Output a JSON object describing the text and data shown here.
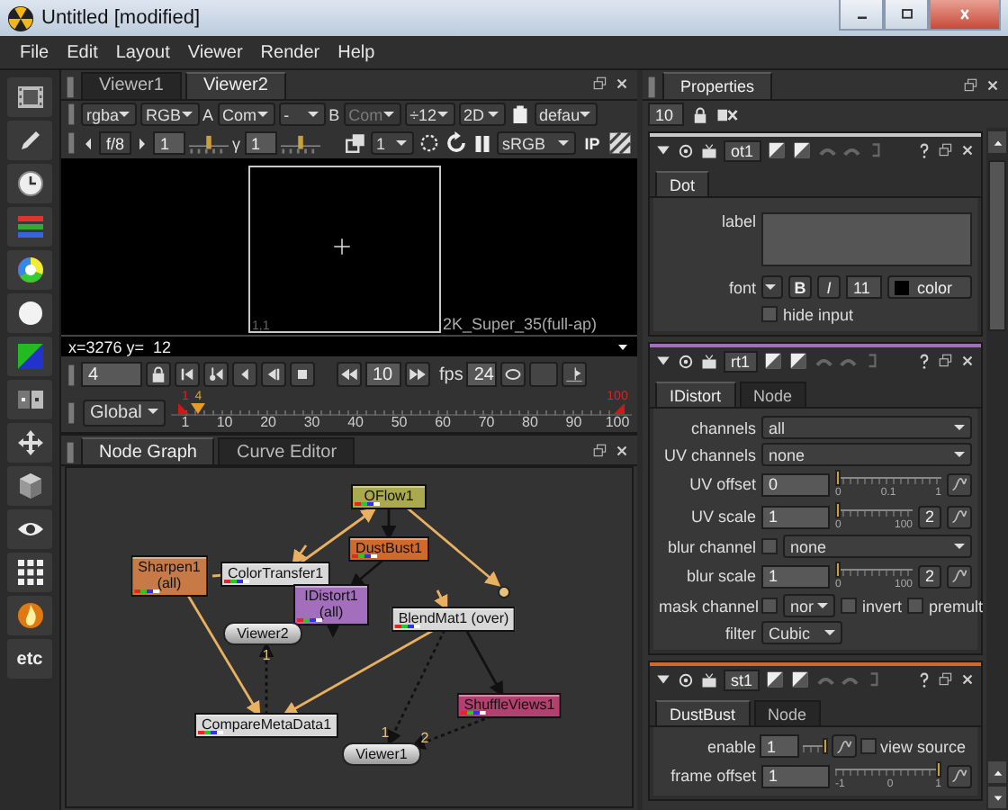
{
  "window": {
    "title": "Untitled [modified]"
  },
  "menu": [
    "File",
    "Edit",
    "Layout",
    "Viewer",
    "Render",
    "Help"
  ],
  "toolbar": {
    "more_label": "etc"
  },
  "viewer": {
    "tabs": [
      {
        "label": "Viewer1",
        "selected": false
      },
      {
        "label": "Viewer2",
        "selected": true
      }
    ],
    "channels": "rgba",
    "display_channel": "RGB",
    "input_a_label": "A",
    "input_a": {
      "value": "Com",
      "disabled": false
    },
    "wipe": "-",
    "input_b_label": "B",
    "input_b": {
      "value": "Com",
      "disabled": true
    },
    "proxy": "÷12",
    "view_mode": "2D",
    "lut_preset": "defau",
    "fstop": "f/8",
    "gain": "1",
    "gamma_label": "γ",
    "gamma": "1",
    "roi_value": "1",
    "colorspace": "sRGB",
    "ip_label": "IP",
    "format_label": "2K_Super_35(full-ap)",
    "corner_label": "1,1",
    "info": "x=3276 y=  12",
    "playback": {
      "frame": "4",
      "increment": "10",
      "fps_label": "fps",
      "fps": "24"
    },
    "timeline": {
      "range": "Global",
      "in_point": "1",
      "current": "4",
      "out_point": "100",
      "level": 0.03,
      "ticks": [
        "1",
        "10",
        "20",
        "30",
        "40",
        "50",
        "60",
        "70",
        "80",
        "90",
        "100"
      ]
    }
  },
  "node_graph": {
    "tabs": [
      {
        "label": "Node Graph",
        "selected": true
      },
      {
        "label": "Curve Editor",
        "selected": false
      }
    ],
    "nodes": [
      {
        "kind": "node",
        "label": "OFlow1",
        "color": "#aaa94e"
      },
      {
        "kind": "node",
        "label": "DustBust1",
        "color": "#cf6a2c"
      },
      {
        "kind": "node",
        "label": "Sharpen1",
        "sublabel": "(all)",
        "color": "#c77a45"
      },
      {
        "kind": "node",
        "label": "ColorTransfer1",
        "color": "#d8d8d8"
      },
      {
        "kind": "node",
        "label": "IDistort1",
        "sublabel": "(all)",
        "color": "#a36fbd"
      },
      {
        "kind": "node",
        "label": "BlendMat1 (over)",
        "color": "#d8d8d8"
      },
      {
        "kind": "viewer",
        "label": "Viewer2",
        "inputs": [
          "1"
        ]
      },
      {
        "kind": "node",
        "label": "ShuffleViews1",
        "color": "#b2416f"
      },
      {
        "kind": "node",
        "label": "CompareMetaData1",
        "color": "#d8d8d8"
      },
      {
        "kind": "viewer",
        "label": "Viewer1",
        "inputs": [
          "1",
          "2"
        ]
      },
      {
        "kind": "dot"
      }
    ]
  },
  "properties": {
    "title": "Properties",
    "max_panels": "10",
    "panels": [
      {
        "name": "ot1",
        "color": "#c8c8c8",
        "tabs": [
          {
            "label": "Dot",
            "selected": true
          }
        ],
        "knobs": [
          {
            "kind": "text_area",
            "label": "label"
          },
          {
            "kind": "font",
            "label": "font",
            "bold": "B",
            "italic": "I",
            "size": "11",
            "color_label": "color"
          },
          {
            "kind": "checkbox",
            "label": "hide input",
            "checked": false
          }
        ]
      },
      {
        "name": "rt1",
        "color": "#a36fbd",
        "tabs": [
          {
            "label": "IDistort",
            "selected": true
          },
          {
            "label": "Node",
            "selected": false
          }
        ],
        "knobs": [
          {
            "kind": "dropdown",
            "label": "channels",
            "value": "all",
            "short": false
          },
          {
            "kind": "dropdown",
            "label": "UV channels",
            "value": "none",
            "short": false
          },
          {
            "kind": "slider",
            "label": "UV offset",
            "value": "0",
            "level": 0,
            "ticks": [
              "0",
              "0.1",
              "1"
            ]
          },
          {
            "kind": "slider",
            "label": "UV scale",
            "value": "1",
            "level": 0.01,
            "ticks": [
              "0",
              "100"
            ],
            "split": "2"
          },
          {
            "kind": "check_dropdown",
            "label": "blur channel",
            "checked": false,
            "value": "none"
          },
          {
            "kind": "slider",
            "label": "blur scale",
            "value": "1",
            "level": 0.01,
            "ticks": [
              "0",
              "100"
            ],
            "split": "2"
          },
          {
            "kind": "mask",
            "label": "mask channel",
            "checked": false,
            "value": "nor",
            "options": [
              {
                "label": "invert",
                "checked": false
              },
              {
                "label": "premult",
                "checked": false
              }
            ]
          },
          {
            "kind": "dropdown",
            "label": "filter",
            "value": "Cubic",
            "short": true
          }
        ]
      },
      {
        "name": "st1",
        "color": "#cf6a2c",
        "tabs": [
          {
            "label": "DustBust",
            "selected": true
          },
          {
            "label": "Node",
            "selected": false
          }
        ],
        "knobs": [
          {
            "kind": "toggle",
            "label": "enable",
            "value": "1",
            "level": 1,
            "option": {
              "label": "view source",
              "checked": false
            }
          },
          {
            "kind": "slider",
            "label": "frame offset",
            "value": "1",
            "level": 1,
            "ticks": [
              "-1",
              "0",
              "1"
            ]
          }
        ]
      }
    ]
  }
}
